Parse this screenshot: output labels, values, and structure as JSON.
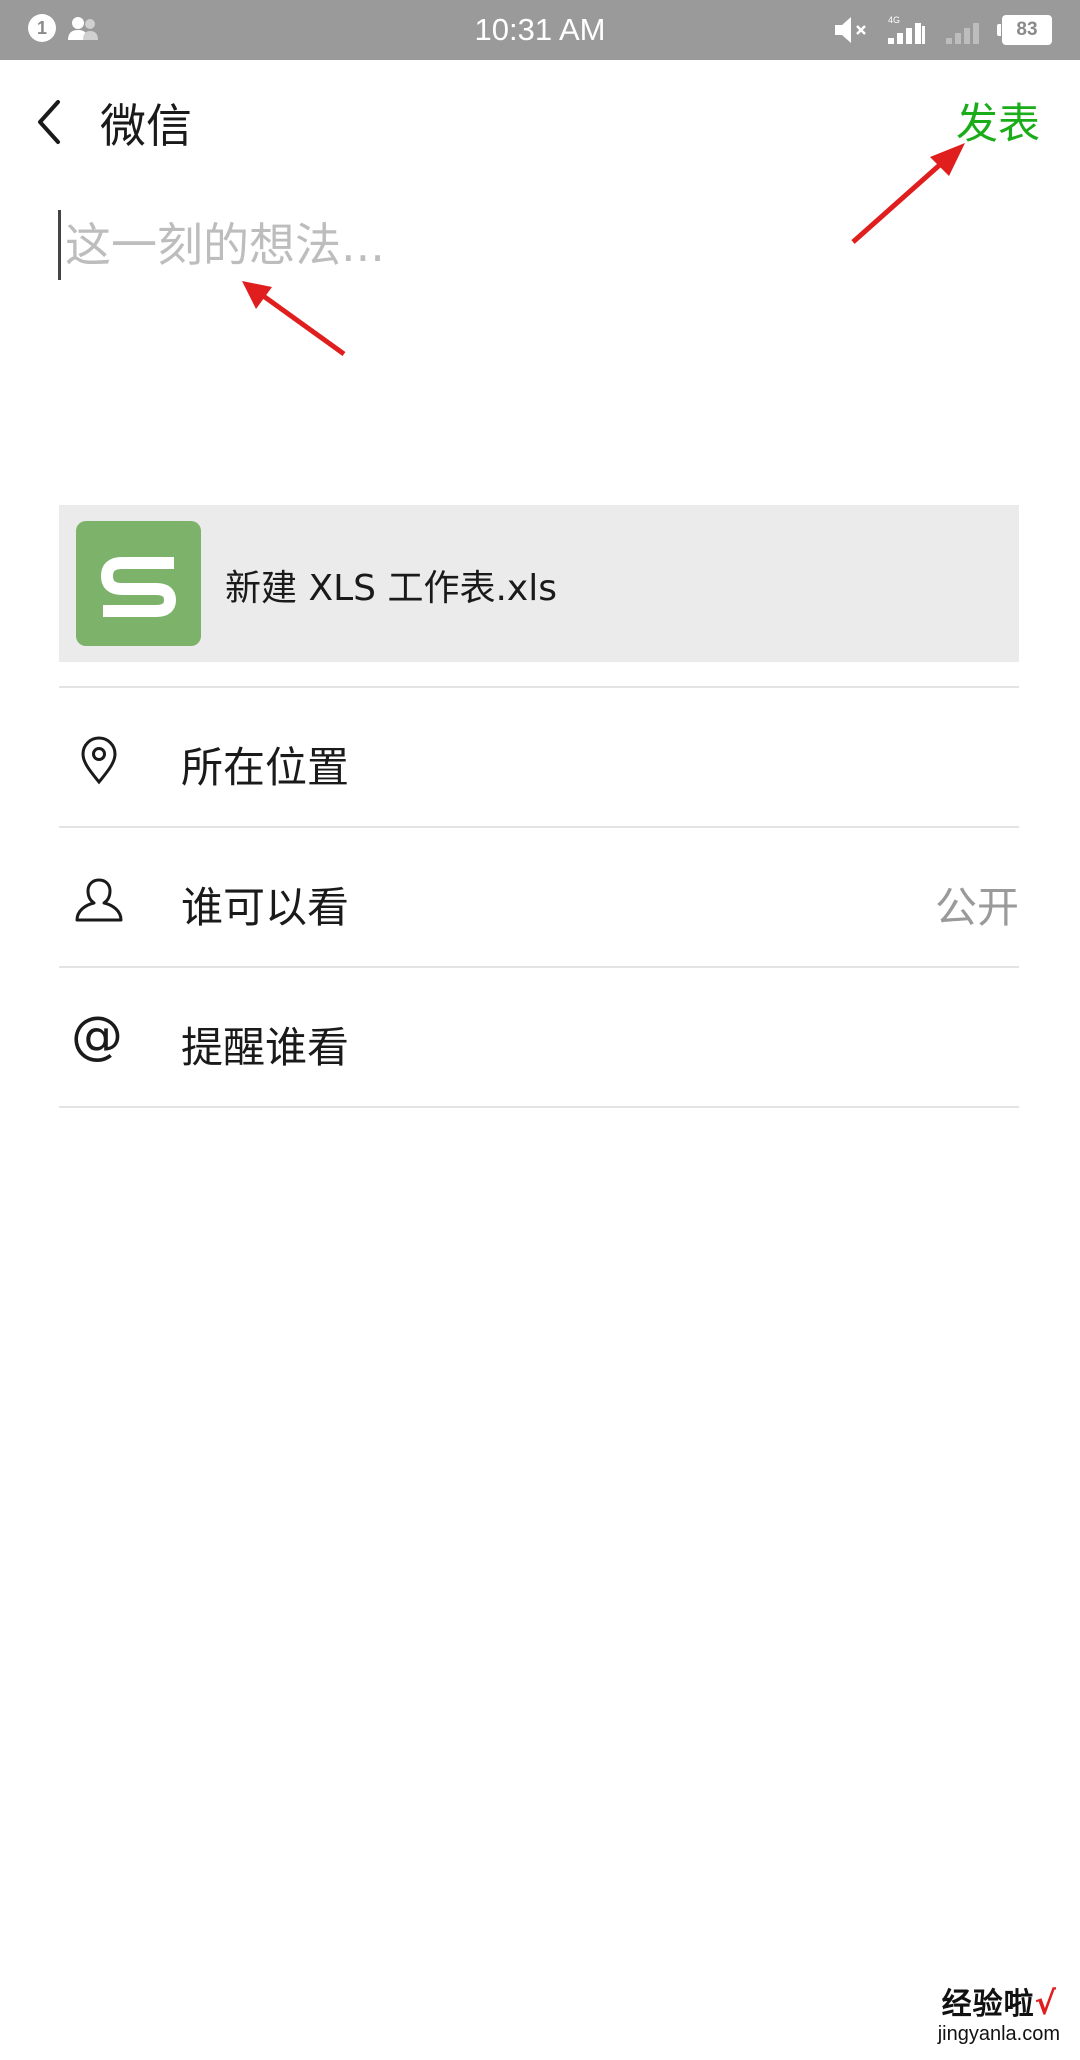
{
  "status_bar": {
    "notification_count": "1",
    "time": "10:31 AM",
    "network_label": "4G",
    "battery": "83"
  },
  "header": {
    "title": "微信",
    "publish_label": "发表"
  },
  "compose": {
    "placeholder": "这一刻的想法..."
  },
  "attachment": {
    "file_name": "新建 XLS 工作表.xls",
    "icon": "wps-spreadsheet-icon",
    "icon_color": "#7cb26a"
  },
  "options": {
    "location_label": "所在位置",
    "visibility_label": "谁可以看",
    "visibility_value": "公开",
    "remind_label": "提醒谁看"
  },
  "watermark": {
    "main": "经验啦",
    "sub": "jingyanla.com"
  },
  "colors": {
    "accent": "#1aad19",
    "annotation_arrow": "#e01e1e",
    "status_bar": "#9a9a9a"
  }
}
